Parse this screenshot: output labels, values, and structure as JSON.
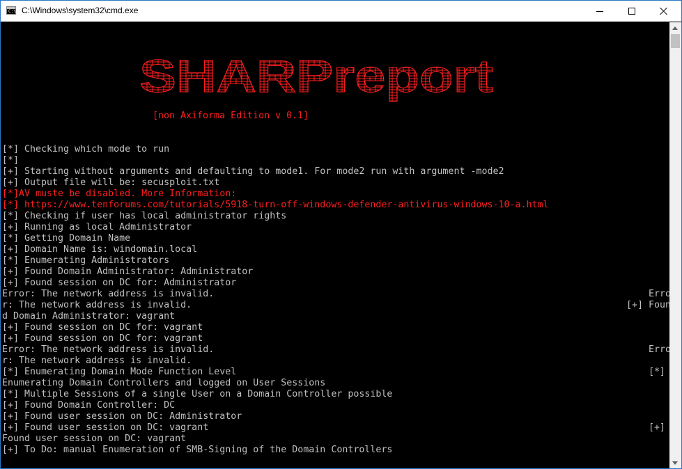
{
  "window": {
    "title": "C:\\Windows\\system32\\cmd.exe",
    "icon": "cmd-icon"
  },
  "controls": {
    "minimize": "minimize-icon",
    "maximize": "maximize-icon",
    "close": "close-icon"
  },
  "banner": {
    "text": "SHARPreport",
    "color": "#ff1f1f",
    "edition": "[non Axiforma Edition v 0.1]"
  },
  "colors": {
    "background": "#000000",
    "text": "#c0c0c0",
    "warning": "#ff1f1f"
  },
  "lines": [
    {
      "text": "[*] Checking which mode to run"
    },
    {
      "text": "[*]"
    },
    {
      "text": "[+] Starting without arguments and defaulting to mode1. For mode2 run with argument -mode2"
    },
    {
      "text": "[+] Output file will be: secusploit.txt"
    },
    {
      "text": "[*]AV muste be disabled. More Information:",
      "red": true
    },
    {
      "text": "[*] https://www.tenforums.com/tutorials/5918-turn-off-windows-defender-antivirus-windows-10-a.html",
      "red": true
    },
    {
      "text": "[*] Checking if user has local administrator rights"
    },
    {
      "text": "[+] Running as local Administrator"
    },
    {
      "text": "[*] Getting Domain Name"
    },
    {
      "text": "[+] Domain Name is: windomain.local"
    },
    {
      "text": "[*] Enumerating Administrators"
    },
    {
      "text": "[+] Found Domain Administrator: Administrator"
    },
    {
      "text": "[+] Found session on DC for: Administrator"
    },
    {
      "text": "Error: The network address is invalid.",
      "tail": "Erro",
      "tail_col": 116
    },
    {
      "text": "r: The network address is invalid.",
      "tail": "[+] Foun",
      "tail_col": 112
    },
    {
      "text": "d Domain Administrator: vagrant"
    },
    {
      "text": "[+] Found session on DC for: vagrant"
    },
    {
      "text": "[+] Found session on DC for: vagrant"
    },
    {
      "text": "Error: The network address is invalid.",
      "tail": "Erro",
      "tail_col": 116
    },
    {
      "text": "r: The network address is invalid."
    },
    {
      "text": "[*] Enumerating Domain Mode Function Level",
      "tail": "[*]",
      "tail_col": 116
    },
    {
      "text": "Enumerating Domain Controllers and logged on User Sessions"
    },
    {
      "text": "[*] Multiple Sessions of a single User on a Domain Controller possible"
    },
    {
      "text": "[+] Found Domain Controller: DC"
    },
    {
      "text": "[+] Found user session on DC: Administrator"
    },
    {
      "text": "[+] Found user session on DC: vagrant",
      "tail": "[+]",
      "tail_col": 116
    },
    {
      "text": "Found user session on DC: vagrant"
    },
    {
      "text": "[+] To Do: manual Enumeration of SMB-Signing of the Domain Controllers"
    }
  ]
}
